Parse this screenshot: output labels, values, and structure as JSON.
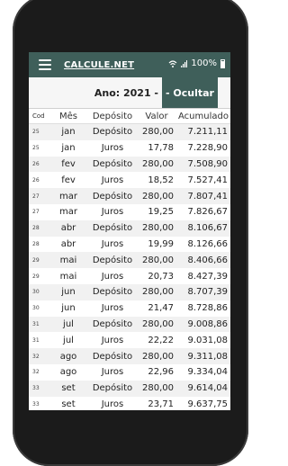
{
  "app": {
    "title": "CALCULE.NET",
    "battery": "100%",
    "colors": {
      "accent": "#3f5f5a"
    }
  },
  "year": {
    "label": "Ano: 2021 -",
    "hide_button": "- Ocultar"
  },
  "table": {
    "headers": [
      "Cod",
      "Mês",
      "Depósito",
      "Valor",
      "Acumulado"
    ],
    "rows": [
      {
        "cod": "25",
        "mes": "jan",
        "tipo": "Depósito",
        "valor": "280,00",
        "acum": "7.211,11"
      },
      {
        "cod": "25",
        "mes": "jan",
        "tipo": "Juros",
        "valor": "17,78",
        "acum": "7.228,90"
      },
      {
        "cod": "26",
        "mes": "fev",
        "tipo": "Depósito",
        "valor": "280,00",
        "acum": "7.508,90"
      },
      {
        "cod": "26",
        "mes": "fev",
        "tipo": "Juros",
        "valor": "18,52",
        "acum": "7.527,41"
      },
      {
        "cod": "27",
        "mes": "mar",
        "tipo": "Depósito",
        "valor": "280,00",
        "acum": "7.807,41"
      },
      {
        "cod": "27",
        "mes": "mar",
        "tipo": "Juros",
        "valor": "19,25",
        "acum": "7.826,67"
      },
      {
        "cod": "28",
        "mes": "abr",
        "tipo": "Depósito",
        "valor": "280,00",
        "acum": "8.106,67"
      },
      {
        "cod": "28",
        "mes": "abr",
        "tipo": "Juros",
        "valor": "19,99",
        "acum": "8.126,66"
      },
      {
        "cod": "29",
        "mes": "mai",
        "tipo": "Depósito",
        "valor": "280,00",
        "acum": "8.406,66"
      },
      {
        "cod": "29",
        "mes": "mai",
        "tipo": "Juros",
        "valor": "20,73",
        "acum": "8.427,39"
      },
      {
        "cod": "30",
        "mes": "jun",
        "tipo": "Depósito",
        "valor": "280,00",
        "acum": "8.707,39"
      },
      {
        "cod": "30",
        "mes": "jun",
        "tipo": "Juros",
        "valor": "21,47",
        "acum": "8.728,86"
      },
      {
        "cod": "31",
        "mes": "jul",
        "tipo": "Depósito",
        "valor": "280,00",
        "acum": "9.008,86"
      },
      {
        "cod": "31",
        "mes": "jul",
        "tipo": "Juros",
        "valor": "22,22",
        "acum": "9.031,08"
      },
      {
        "cod": "32",
        "mes": "ago",
        "tipo": "Depósito",
        "valor": "280,00",
        "acum": "9.311,08"
      },
      {
        "cod": "32",
        "mes": "ago",
        "tipo": "Juros",
        "valor": "22,96",
        "acum": "9.334,04"
      },
      {
        "cod": "33",
        "mes": "set",
        "tipo": "Depósito",
        "valor": "280,00",
        "acum": "9.614,04"
      },
      {
        "cod": "33",
        "mes": "set",
        "tipo": "Juros",
        "valor": "23,71",
        "acum": "9.637,75"
      }
    ]
  }
}
